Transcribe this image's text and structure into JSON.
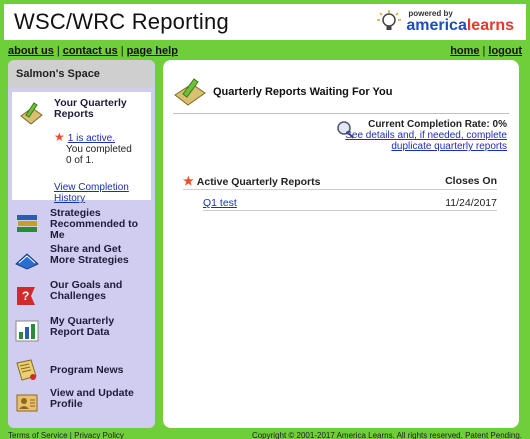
{
  "header": {
    "title": "WSC/WRC Reporting",
    "brand_powered": "powered by",
    "brand_name_main": "america",
    "brand_name_accent": "learns"
  },
  "topnav": {
    "left": [
      "about us",
      "contact us",
      "page help"
    ],
    "right": [
      "home",
      "logout"
    ]
  },
  "sidebar": {
    "title": "Salmon's Space",
    "active": {
      "label": "Your Quarterly Reports",
      "active_link": "1 is active.",
      "completed_line1": "You completed",
      "completed_line2": "0 of 1.",
      "history_link": "View Completion History"
    },
    "items": [
      {
        "label": "Strategies Recommended to Me",
        "icon": "books-icon"
      },
      {
        "label": "Share and Get More Strategies",
        "icon": "book-share-icon"
      },
      {
        "label": "Our Goals and Challenges",
        "icon": "goals-icon"
      },
      {
        "label": "My Quarterly Report Data",
        "icon": "bar-chart-icon"
      },
      {
        "label": "Program News",
        "icon": "news-icon"
      },
      {
        "label": "View and Update Profile",
        "icon": "profile-icon"
      }
    ]
  },
  "main": {
    "title": "Quarterly Reports Waiting For You",
    "completion_rate": "Current Completion Rate: 0%",
    "details_link_line1": "See details and, if needed, complete",
    "details_link_line2": "duplicate quarterly reports",
    "table": {
      "col_report": "Active Quarterly Reports",
      "col_closes": "Closes On",
      "rows": [
        {
          "name": "Q1 test",
          "closes": "11/24/2017"
        }
      ]
    }
  },
  "footer": {
    "left1": "Terms of Service",
    "left2": "Privacy Policy",
    "right": "Copyright © 2001-2017 America Learns. All rights reserved. Patent Pending."
  }
}
